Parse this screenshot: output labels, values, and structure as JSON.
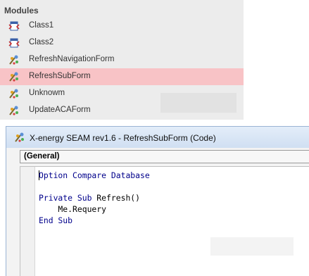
{
  "modules": {
    "header": "Modules",
    "items": [
      {
        "label": "Class1",
        "icon": "class-module-icon",
        "selected": false
      },
      {
        "label": "Class2",
        "icon": "class-module-icon",
        "selected": false
      },
      {
        "label": "RefreshNavigationForm",
        "icon": "form-module-icon",
        "selected": false
      },
      {
        "label": "RefreshSubForm",
        "icon": "form-module-icon",
        "selected": true
      },
      {
        "label": "Unknowm",
        "icon": "form-module-icon",
        "selected": false
      },
      {
        "label": "UpdateACAForm",
        "icon": "form-module-icon",
        "selected": false
      }
    ],
    "selected_color": "#f8c3c6"
  },
  "code_window": {
    "title": "X-energy SEAM rev1.6 - RefreshSubForm (Code)",
    "object_dropdown": "(General)",
    "keyword_color": "#00008b",
    "lines": [
      {
        "kw": "Option Compare Database",
        "text": ""
      },
      {
        "kw": "",
        "text": ""
      },
      {
        "kw": "Private Sub ",
        "text": "Refresh()"
      },
      {
        "kw": "",
        "text": "    Me.Requery"
      },
      {
        "kw": "End Sub",
        "text": ""
      }
    ]
  }
}
